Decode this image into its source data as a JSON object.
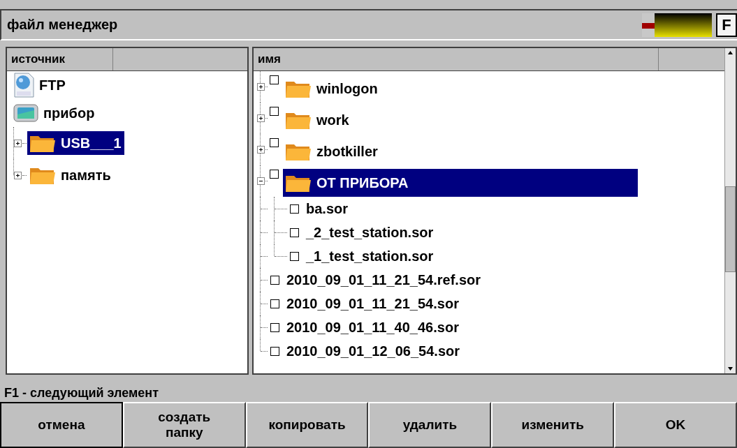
{
  "window": {
    "title": "файл менеджер",
    "header_button": "F"
  },
  "source_panel": {
    "columns": [
      {
        "label": "источник"
      }
    ],
    "tree": [
      {
        "label": "FTP",
        "kind": "ftp",
        "selected": false
      },
      {
        "label": "прибор",
        "kind": "device",
        "selected": false,
        "children": [
          {
            "label": "USB___1",
            "kind": "folder",
            "expanded": false,
            "selected": true
          },
          {
            "label": "память",
            "kind": "folder",
            "expanded": false,
            "selected": false
          }
        ]
      }
    ]
  },
  "files_panel": {
    "columns": [
      {
        "label": "имя"
      }
    ],
    "tree": [
      {
        "label": "winlogon",
        "kind": "folder",
        "expanded": false,
        "checked": false,
        "selected": false
      },
      {
        "label": "work",
        "kind": "folder",
        "expanded": false,
        "checked": false,
        "selected": false
      },
      {
        "label": "zbotkiller",
        "kind": "folder",
        "expanded": false,
        "checked": false,
        "selected": false
      },
      {
        "label": "ОТ ПРИБОРА",
        "kind": "folder",
        "expanded": true,
        "checked": false,
        "selected": true,
        "children": [
          {
            "label": "ba.sor",
            "kind": "file",
            "checked": false,
            "selected": false
          },
          {
            "label": "_2_test_station.sor",
            "kind": "file",
            "checked": false,
            "selected": false
          },
          {
            "label": "_1_test_station.sor",
            "kind": "file",
            "checked": false,
            "selected": false
          }
        ]
      },
      {
        "label": "2010_09_01_11_21_54.ref.sor",
        "kind": "file",
        "checked": false,
        "selected": false
      },
      {
        "label": "2010_09_01_11_21_54.sor",
        "kind": "file",
        "checked": false,
        "selected": false
      },
      {
        "label": "2010_09_01_11_40_46.sor",
        "kind": "file",
        "checked": false,
        "selected": false
      },
      {
        "label": "2010_09_01_12_06_54.sor",
        "kind": "file",
        "checked": false,
        "selected": false
      }
    ]
  },
  "status_bar": "F1 - следующий элемент",
  "buttons": [
    "отмена",
    "создать папку",
    "копировать",
    "удалить",
    "изменить",
    "OK"
  ]
}
